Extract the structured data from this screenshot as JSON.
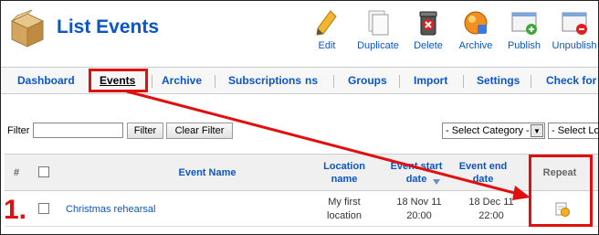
{
  "header": {
    "title": "List Events",
    "toolbar": [
      {
        "label": "Edit",
        "icon": "pencil-icon"
      },
      {
        "label": "Duplicate",
        "icon": "document-copy-icon"
      },
      {
        "label": "Delete",
        "icon": "trash-icon"
      },
      {
        "label": "Archive",
        "icon": "archive-icon"
      },
      {
        "label": "Publish",
        "icon": "publish-icon"
      },
      {
        "label": "Unpublish",
        "icon": "unpublish-icon"
      }
    ]
  },
  "submenu": {
    "items": [
      "Dashboard",
      "Events",
      "Archive",
      "Subscriptions",
      "ns",
      "Groups",
      "Import",
      "Settings",
      "Check for"
    ],
    "active": "Events"
  },
  "filter": {
    "label": "Filter",
    "value": "",
    "filter_button": "Filter",
    "clear_button": "Clear Filter",
    "category_select": "- Select Category -",
    "location_select": "- Select Lo"
  },
  "table": {
    "headers": {
      "num": "#",
      "name": "Event Name",
      "location": "Location name",
      "start": "Event start date",
      "end": "Event end date",
      "repeat": "Repeat"
    },
    "rows": [
      {
        "name": "Christmas rehearsal",
        "location": "My first location",
        "start_date": "18 Nov 11",
        "start_time": "20:00",
        "end_date": "18 Dec 11",
        "end_time": "22:00",
        "repeat_icon": "repeat-icon"
      }
    ]
  },
  "annotation": {
    "step": "1.",
    "color": "#e01010"
  },
  "colors": {
    "link": "#0b55c4",
    "highlight": "#e01010"
  }
}
